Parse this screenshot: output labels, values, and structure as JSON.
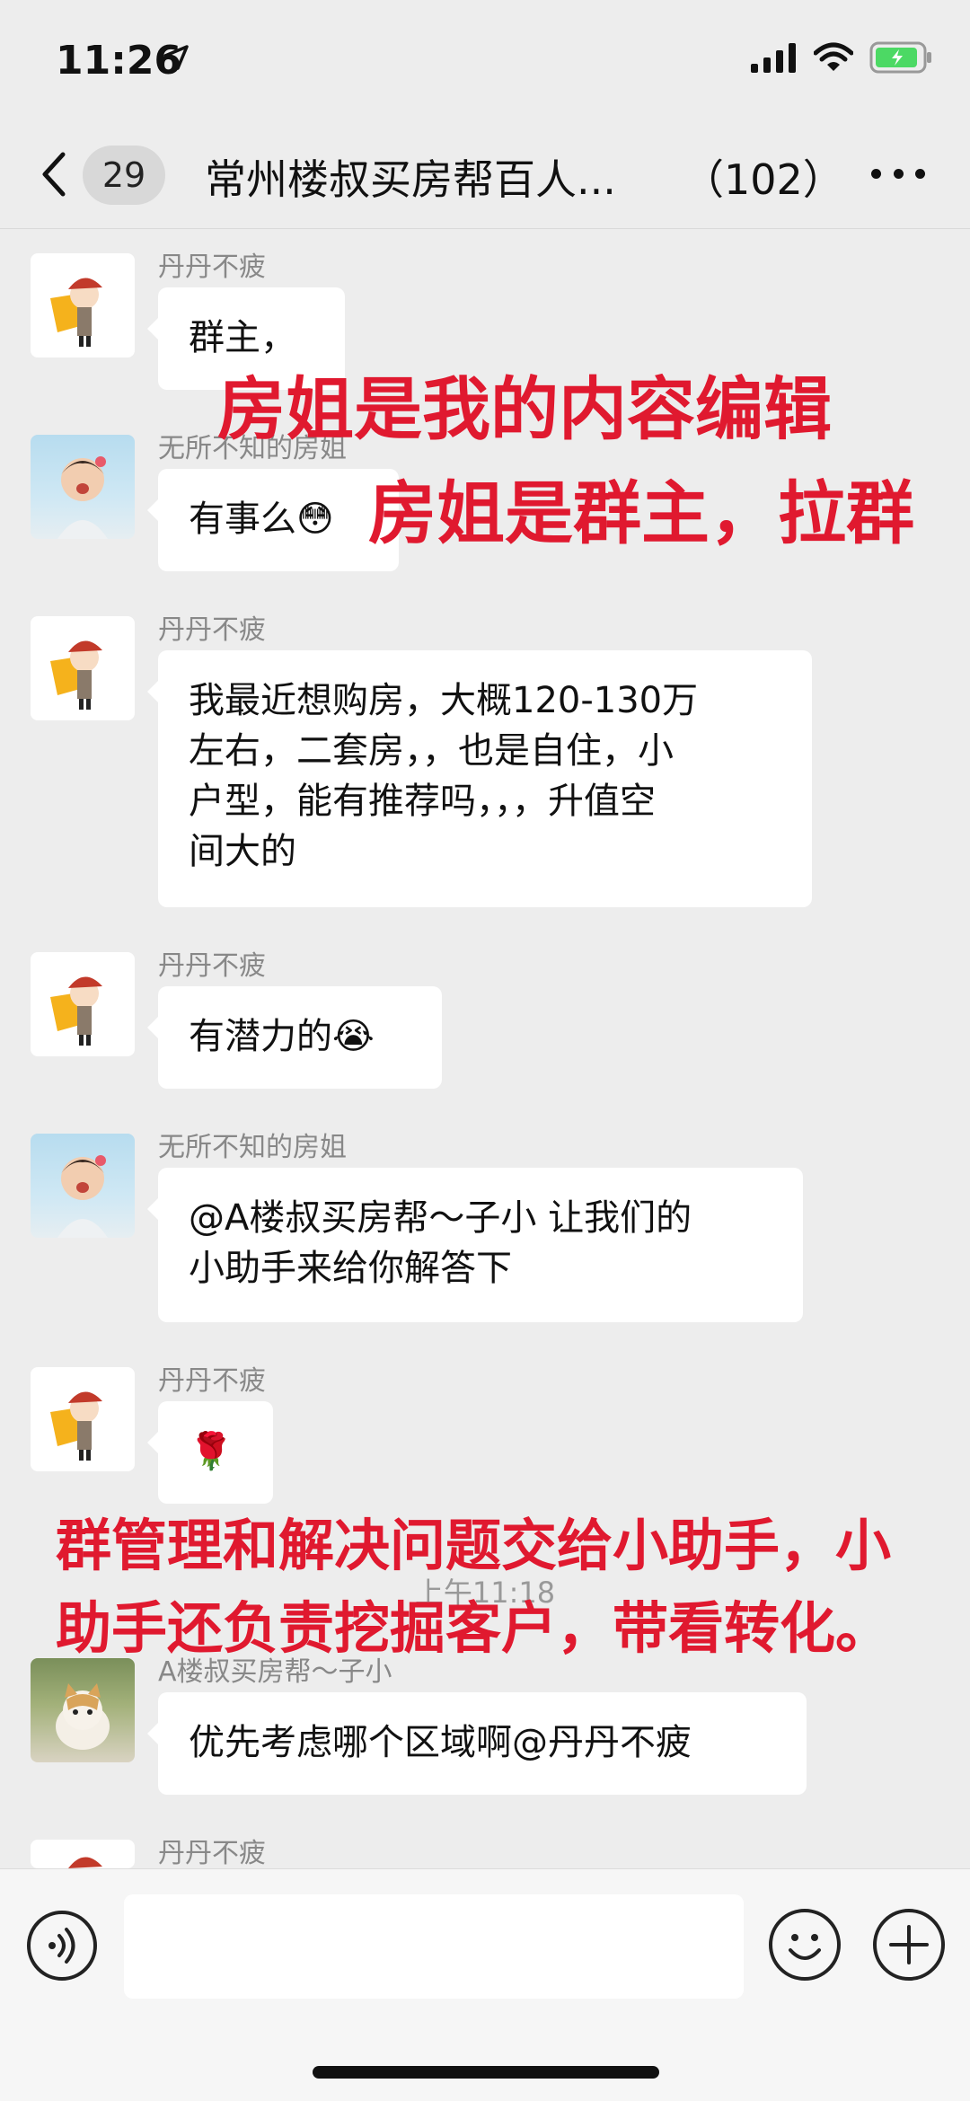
{
  "status_bar": {
    "time": "11:26"
  },
  "nav": {
    "badge_count": "29",
    "title": "常州楼叔买房帮百人...",
    "member_count": "（102）"
  },
  "messages": [
    {
      "sender": "丹丹不疲",
      "text": "群主，",
      "avatar": "girl-avatar"
    },
    {
      "sender": "无所不知的房姐",
      "text": "有事么😳",
      "avatar": "kid-avatar"
    },
    {
      "sender": "丹丹不疲",
      "lines": [
        "我最近想购房，大概120-130万",
        "左右，二套房，，也是自住，小",
        "户型，能有推荐吗，，，升值空",
        "间大的"
      ],
      "avatar": "girl-avatar"
    },
    {
      "sender": "丹丹不疲",
      "text": "有潜力的😭",
      "avatar": "girl-avatar"
    },
    {
      "sender": "无所不知的房姐",
      "lines": [
        "@A楼叔买房帮～子小 让我们的",
        "小助手来给你解答下"
      ],
      "avatar": "kid-avatar"
    },
    {
      "sender": "丹丹不疲",
      "text": "🌹",
      "avatar": "girl-avatar"
    },
    {
      "sender": "A楼叔买房帮～子小",
      "text": "优先考虑哪个区域啊@丹丹不疲",
      "avatar": "cat-avatar"
    },
    {
      "sender": "丹丹不疲",
      "avatar": "girl-avatar"
    }
  ],
  "timestamp": "上午11:18",
  "overlays": {
    "line1": "房姐是我的内容编辑",
    "line2": "房姐是群主，拉群",
    "line3": "群管理和解决问题交给小助手，小",
    "line4": "助手还负责挖掘客户，带看转化。"
  },
  "colors": {
    "overlay_red": "#e0192f",
    "background": "#ededed"
  }
}
